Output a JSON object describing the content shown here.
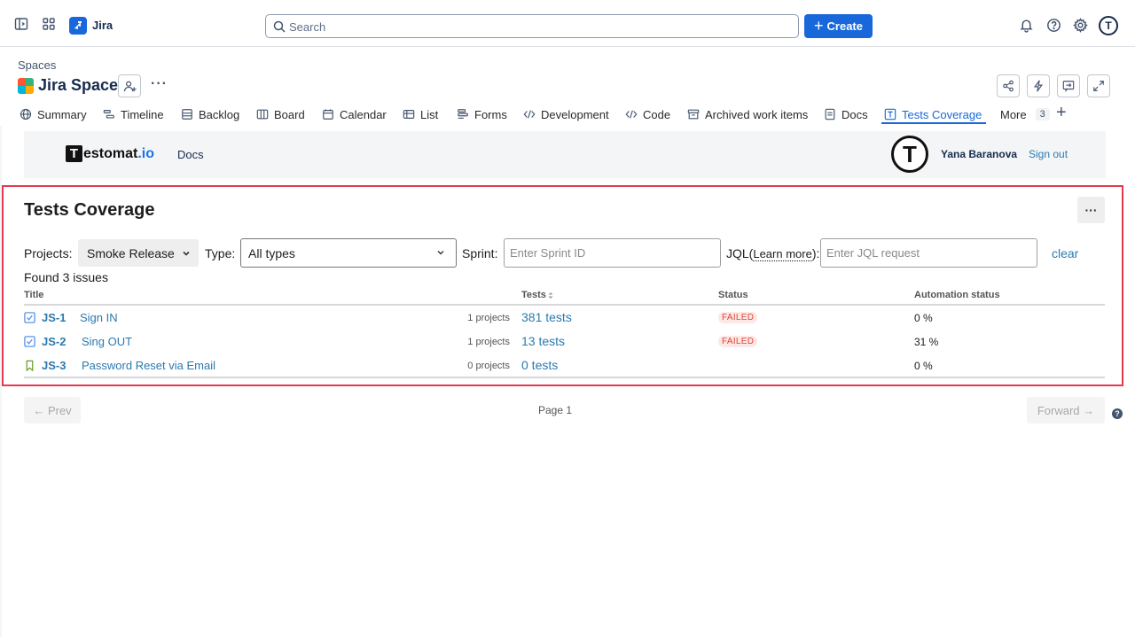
{
  "topbar": {
    "app_name": "Jira",
    "search_placeholder": "Search",
    "create_label": "Create",
    "avatar_initial": "T"
  },
  "space": {
    "breadcrumb": "Spaces",
    "title": "Jira Space"
  },
  "tabs": [
    {
      "label": "Summary",
      "icon": "globe-icon"
    },
    {
      "label": "Timeline",
      "icon": "timeline-icon"
    },
    {
      "label": "Backlog",
      "icon": "backlog-icon"
    },
    {
      "label": "Board",
      "icon": "board-icon"
    },
    {
      "label": "Calendar",
      "icon": "calendar-icon"
    },
    {
      "label": "List",
      "icon": "list-icon"
    },
    {
      "label": "Forms",
      "icon": "forms-icon"
    },
    {
      "label": "Development",
      "icon": "code-icon"
    },
    {
      "label": "Code",
      "icon": "code-icon"
    },
    {
      "label": "Archived work items",
      "icon": "archive-icon"
    },
    {
      "label": "Docs",
      "icon": "page-icon"
    },
    {
      "label": "Tests Coverage",
      "icon": "testomat-icon",
      "active": true
    },
    {
      "label": "More",
      "count": "3"
    }
  ],
  "testomat": {
    "logo_t": "T",
    "logo_name": "estomat",
    "logo_suffix": ".io",
    "docs_link": "Docs",
    "avatar_initial": "T",
    "user_name": "Yana Baranova",
    "sign_out": "Sign out"
  },
  "coverage": {
    "title": "Tests Coverage",
    "menu_label": "···",
    "projects_label": "Projects:",
    "projects_value": "Smoke Release",
    "type_label": "Type:",
    "type_value": "All types",
    "sprint_label": "Sprint:",
    "sprint_placeholder": "Enter Sprint ID",
    "jql_label_prefix": "JQL(",
    "jql_learn_more": "Learn more",
    "jql_label_suffix": "):",
    "jql_placeholder": "Enter JQL request",
    "clear_label": "clear",
    "found_text": "Found 3 issues"
  },
  "table": {
    "headers": {
      "title": "Title",
      "tests": "Tests",
      "status": "Status",
      "automation": "Automation status"
    },
    "rows": [
      {
        "key": "JS-1",
        "summary": "Sign IN",
        "projects": "1 projects",
        "tests": "381 tests",
        "status": "FAILED",
        "automation": "0 %",
        "type_icon": "checkbox-icon"
      },
      {
        "key": "JS-2",
        "summary": "Sing OUT",
        "projects": "1 projects",
        "tests": "13 tests",
        "status": "FAILED",
        "automation": "31 %",
        "type_icon": "checkbox-icon"
      },
      {
        "key": "JS-3",
        "summary": "Password Reset via Email",
        "projects": "0 projects",
        "tests": "0 tests",
        "status": "",
        "automation": "0 %",
        "type_icon": "bookmark-icon"
      }
    ]
  },
  "pagination": {
    "prev_label": "← Prev",
    "page_label": "Page 1",
    "forward_label": "Forward →"
  },
  "colors": {
    "accent": "#1868db",
    "link": "#2a7ab0",
    "failed": "#d9463b",
    "highlight": "#e5394f"
  }
}
